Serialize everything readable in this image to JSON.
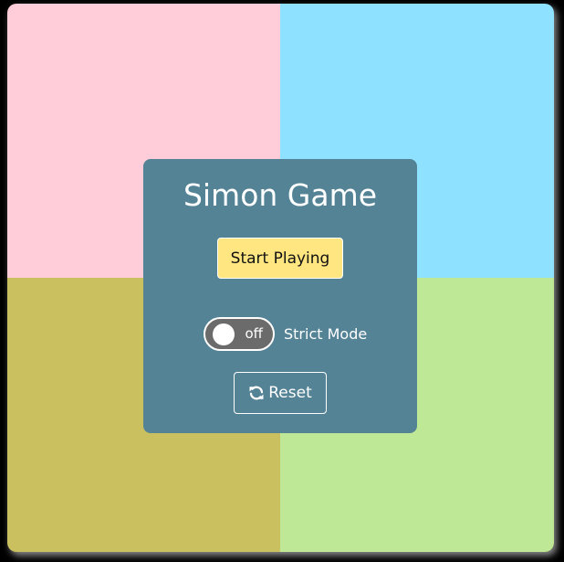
{
  "game": {
    "title": "Simon Game",
    "start_label": "Start Playing",
    "strict_toggle_state": "off",
    "strict_label": "Strict Mode",
    "reset_label": "Reset"
  },
  "colors": {
    "top_left": "#ffcdd9",
    "top_right": "#8ee2ff",
    "bottom_left": "#cbc060",
    "bottom_right": "#bee895",
    "panel": "#548396",
    "start_button": "#ffe680"
  },
  "icons": {
    "reset": "refresh-icon"
  }
}
